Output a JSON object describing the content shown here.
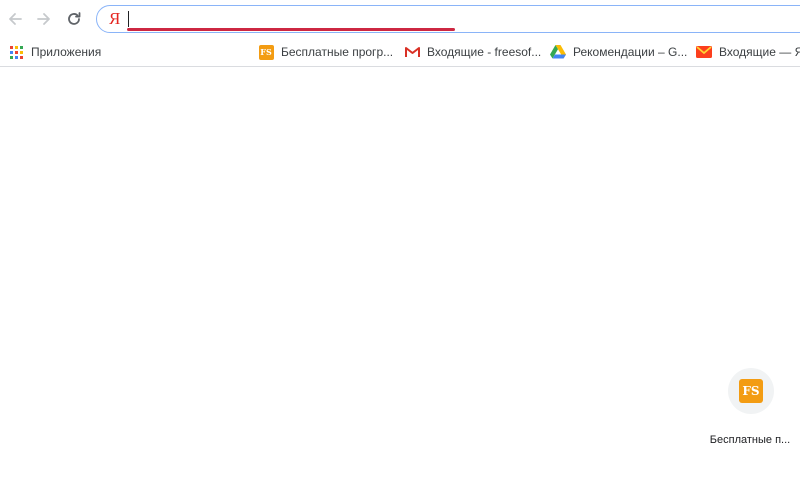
{
  "browser": {
    "nav": {
      "back_icon": "arrow-left-icon",
      "forward_icon": "arrow-right-icon",
      "reload_icon": "reload-icon"
    },
    "omnibox": {
      "logo": "Я",
      "logo_color": "#e52620",
      "value": "",
      "underline_color": "#c8102e"
    },
    "bookmarks": [
      {
        "label": "Приложения",
        "icon": "apps-grid-icon"
      },
      {
        "label": "Бесплатные прогр...",
        "icon": "freesoft-icon"
      },
      {
        "label": "Входящие - freesof...",
        "icon": "gmail-icon"
      },
      {
        "label": "Рекомендации – G...",
        "icon": "google-drive-icon"
      },
      {
        "label": "Входящие — Як",
        "icon": "yandex-mail-icon"
      }
    ]
  },
  "newtab": {
    "tiles": [
      {
        "icon_text": "FS",
        "label": "Бесплатные п..."
      }
    ]
  }
}
